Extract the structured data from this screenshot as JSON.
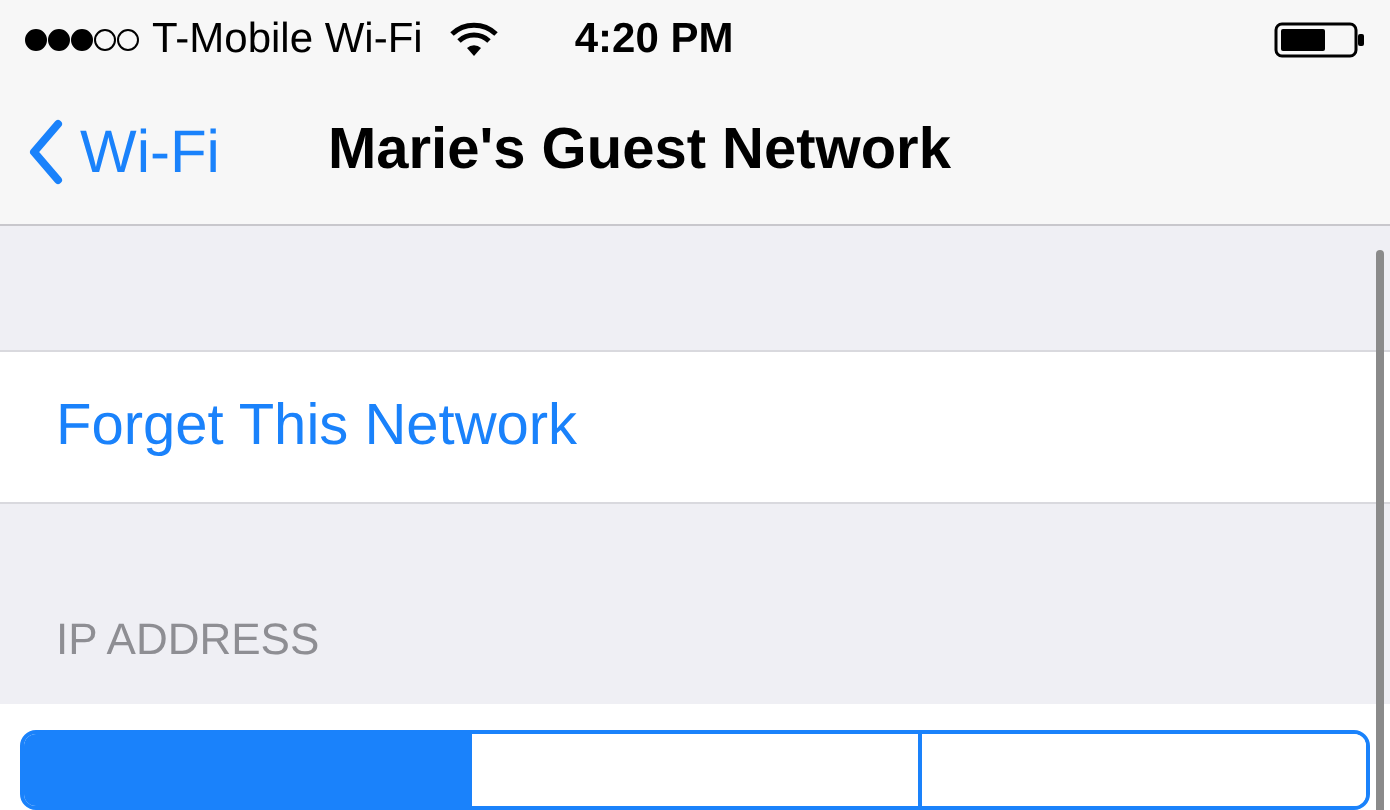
{
  "status_bar": {
    "carrier": "T-Mobile Wi-Fi",
    "time": "4:20 PM"
  },
  "nav_bar": {
    "back": "Wi-Fi",
    "title": "Marie's Guest Network"
  },
  "actions": [
    {
      "label": "Forget This Network"
    }
  ],
  "ip_address": {
    "header": "IP ADDRESS",
    "segments": [
      {
        "selected": true
      },
      {
        "selected": false
      },
      {
        "selected": false
      }
    ]
  }
}
